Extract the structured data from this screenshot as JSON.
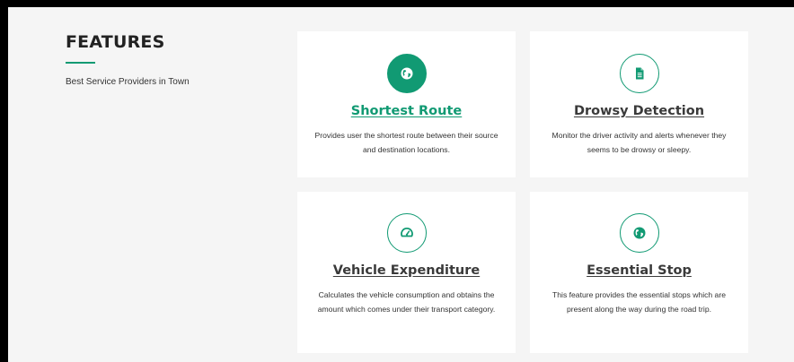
{
  "section": {
    "title": "FEATURES",
    "subtitle": "Best Service Providers in Town"
  },
  "cards": [
    {
      "icon": "globe-icon",
      "title": "Shortest Route",
      "description": "Provides user the shortest route between their source and destination locations."
    },
    {
      "icon": "document-icon",
      "title": "Drowsy Detection",
      "description": "Monitor the driver activity and alerts whenever they seems to be drowsy or sleepy."
    },
    {
      "icon": "speedometer-icon",
      "title": "Vehicle Expenditure",
      "description": "Calculates the vehicle consumption and obtains the amount which comes under their transport category."
    },
    {
      "icon": "globe-icon",
      "title": "Essential Stop",
      "description": "This feature provides the essential stops which are present along the way during the road trip."
    }
  ],
  "colors": {
    "accent": "#119a73",
    "background": "#f5f5f5",
    "card": "#ffffff",
    "text": "#333333"
  }
}
